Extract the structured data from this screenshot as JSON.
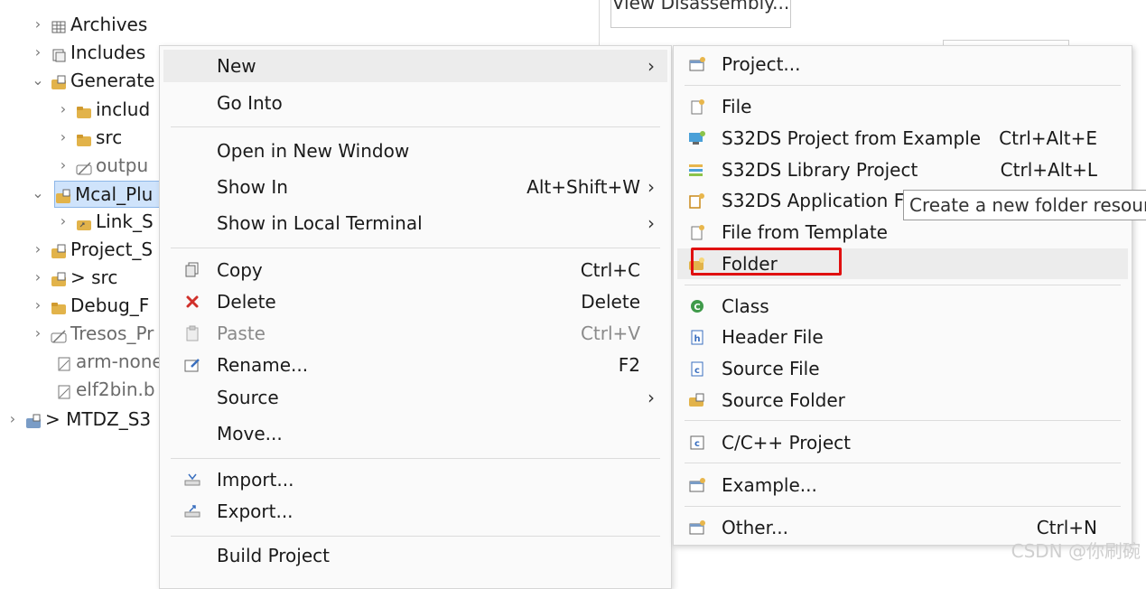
{
  "tree": {
    "items": [
      {
        "label": "Archives",
        "icon": "archive-icon",
        "chevron": "›"
      },
      {
        "label": "Includes",
        "icon": "includes-icon",
        "chevron": "›"
      },
      {
        "label": "Generate",
        "icon": "source-folder-icon",
        "chevron": "⌄"
      },
      {
        "label": "includ",
        "icon": "folder-icon",
        "chevron": "›"
      },
      {
        "label": "src",
        "icon": "folder-icon",
        "chevron": "›"
      },
      {
        "label": "outpu",
        "icon": "excluded-folder-icon",
        "chevron": "›"
      },
      {
        "label": "Mcal_Plu",
        "icon": "linked-folder-icon",
        "chevron": "⌄"
      },
      {
        "label": "Link_S",
        "icon": "link-folder-icon",
        "chevron": "›"
      },
      {
        "label": "Project_S",
        "icon": "source-folder-icon",
        "chevron": "›"
      },
      {
        "label": "> src",
        "icon": "source-folder-icon",
        "chevron": "›"
      },
      {
        "label": "Debug_F",
        "icon": "folder-icon",
        "chevron": "›"
      },
      {
        "label": "Tresos_Pr",
        "icon": "excluded-folder-icon",
        "chevron": "›"
      },
      {
        "label": "arm-none",
        "icon": "file-icon",
        "chevron": ""
      },
      {
        "label": "elf2bin.b",
        "icon": "file-icon",
        "chevron": ""
      },
      {
        "label": "> MTDZ_S3",
        "icon": "project-icon",
        "chevron": "›"
      }
    ]
  },
  "editor": {
    "disassembly_button": "View Disassembly..."
  },
  "menu": {
    "items": [
      {
        "label": "New",
        "shortcut": "",
        "arrow": "›",
        "icon": ""
      },
      {
        "label": "Go Into",
        "shortcut": "",
        "arrow": "",
        "icon": ""
      },
      {
        "label": "Open in New Window",
        "shortcut": "",
        "arrow": "",
        "icon": ""
      },
      {
        "label": "Show In",
        "shortcut": "Alt+Shift+W",
        "arrow": "›",
        "icon": ""
      },
      {
        "label": "Show in Local Terminal",
        "shortcut": "",
        "arrow": "›",
        "icon": ""
      },
      {
        "label": "Copy",
        "shortcut": "Ctrl+C",
        "arrow": "",
        "icon": "copy-icon"
      },
      {
        "label": "Delete",
        "shortcut": "Delete",
        "arrow": "",
        "icon": "delete-icon"
      },
      {
        "label": "Paste",
        "shortcut": "Ctrl+V",
        "arrow": "",
        "icon": "paste-icon"
      },
      {
        "label": "Rename...",
        "shortcut": "F2",
        "arrow": "",
        "icon": "rename-icon"
      },
      {
        "label": "Source",
        "shortcut": "",
        "arrow": "›",
        "icon": ""
      },
      {
        "label": "Move...",
        "shortcut": "",
        "arrow": "",
        "icon": ""
      },
      {
        "label": "Import...",
        "shortcut": "",
        "arrow": "",
        "icon": "import-icon"
      },
      {
        "label": "Export...",
        "shortcut": "",
        "arrow": "",
        "icon": "export-icon"
      },
      {
        "label": "Build Project",
        "shortcut": "",
        "arrow": "",
        "icon": ""
      }
    ]
  },
  "submenu": {
    "items": [
      {
        "label": "Project...",
        "shortcut": "",
        "icon": "new-project-icon"
      },
      {
        "label": "File",
        "shortcut": "",
        "icon": "new-file-icon"
      },
      {
        "label": "S32DS Project from Example",
        "shortcut": "Ctrl+Alt+E",
        "icon": "example-project-icon"
      },
      {
        "label": "S32DS Library Project",
        "shortcut": "Ctrl+Alt+L",
        "icon": "library-project-icon"
      },
      {
        "label": "S32DS Application F",
        "shortcut": "",
        "icon": "application-project-icon"
      },
      {
        "label": "File from Template",
        "shortcut": "",
        "icon": "template-file-icon"
      },
      {
        "label": "Folder",
        "shortcut": "",
        "icon": "new-folder-icon"
      },
      {
        "label": "Class",
        "shortcut": "",
        "icon": "class-icon"
      },
      {
        "label": "Header File",
        "shortcut": "",
        "icon": "header-file-icon"
      },
      {
        "label": "Source File",
        "shortcut": "",
        "icon": "source-file-icon"
      },
      {
        "label": "Source Folder",
        "shortcut": "",
        "icon": "source-folder-icon"
      },
      {
        "label": "C/C++ Project",
        "shortcut": "",
        "icon": "cpp-project-icon"
      },
      {
        "label": "Example...",
        "shortcut": "",
        "icon": "example-icon"
      },
      {
        "label": "Other...",
        "shortcut": "Ctrl+N",
        "icon": "other-icon"
      }
    ]
  },
  "tooltip": {
    "text": "Create a new folder resource"
  },
  "watermark": {
    "text": "CSDN @你刷碗"
  },
  "colors": {
    "highlight_box": "#e01010",
    "menu_bg": "#fafafa",
    "hover": "#ececec",
    "selection": "#cfe3fb"
  }
}
